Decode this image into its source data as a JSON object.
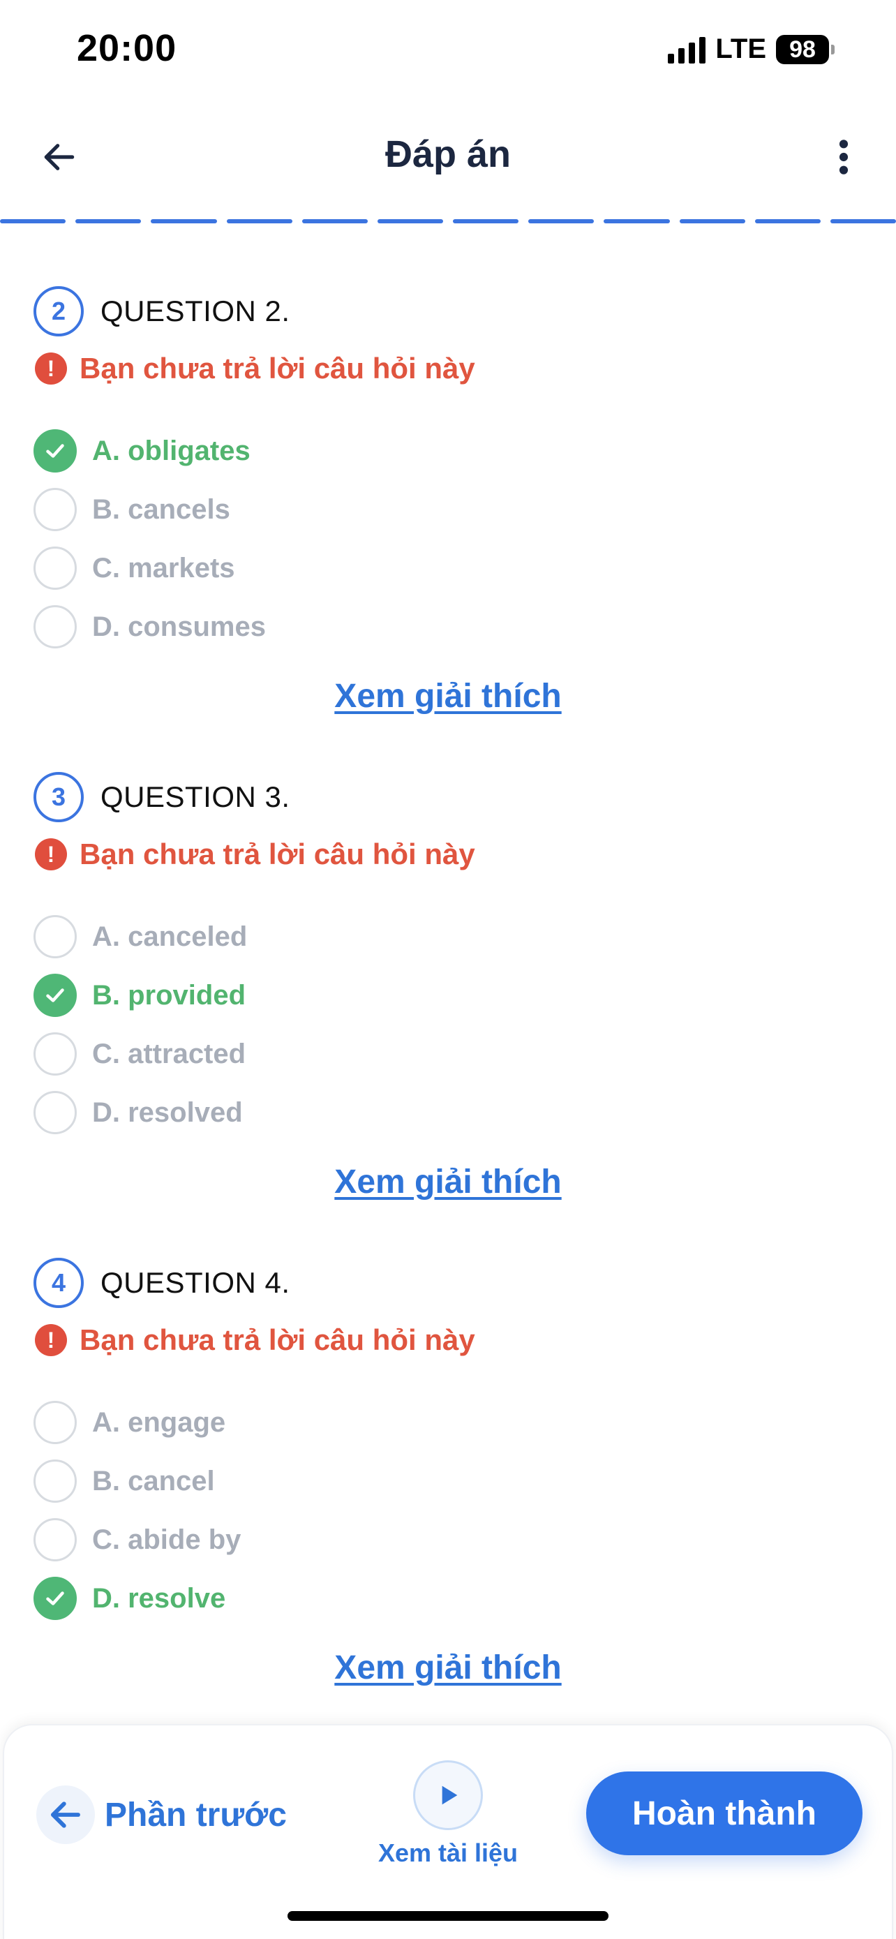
{
  "status_bar": {
    "time": "20:00",
    "network": "LTE",
    "battery": "98"
  },
  "header": {
    "title": "Đáp án",
    "back_icon": "arrow-left-icon",
    "menu_icon": "more-vertical-icon"
  },
  "progress_segments": 12,
  "colors": {
    "accent": "#2f74e8",
    "correct": "#52b46f",
    "warning": "#e0553f",
    "muted": "#a7adb8"
  },
  "questions": [
    {
      "number": "2",
      "title": "QUESTION 2.",
      "warning": "Bạn chưa trả lời câu hỏi này",
      "options": [
        {
          "label": "A. obligates",
          "correct": true
        },
        {
          "label": "B. cancels",
          "correct": false
        },
        {
          "label": "C. markets",
          "correct": false
        },
        {
          "label": "D. consumes",
          "correct": false
        }
      ],
      "explain_label": "Xem giải thích"
    },
    {
      "number": "3",
      "title": "QUESTION 3.",
      "warning": "Bạn chưa trả lời câu hỏi này",
      "options": [
        {
          "label": "A. canceled",
          "correct": false
        },
        {
          "label": "B. provided",
          "correct": true
        },
        {
          "label": "C. attracted",
          "correct": false
        },
        {
          "label": "D. resolved",
          "correct": false
        }
      ],
      "explain_label": "Xem giải thích"
    },
    {
      "number": "4",
      "title": "QUESTION 4.",
      "warning": "Bạn chưa trả lời câu hỏi này",
      "options": [
        {
          "label": "A. engage",
          "correct": false
        },
        {
          "label": "B. cancel",
          "correct": false
        },
        {
          "label": "C. abide by",
          "correct": false
        },
        {
          "label": "D. resolve",
          "correct": true
        }
      ],
      "explain_label": "Xem giải thích"
    }
  ],
  "bottom_bar": {
    "prev_label": "Phần trước",
    "docs_label": "Xem tài liệu",
    "finish_label": "Hoàn thành"
  }
}
